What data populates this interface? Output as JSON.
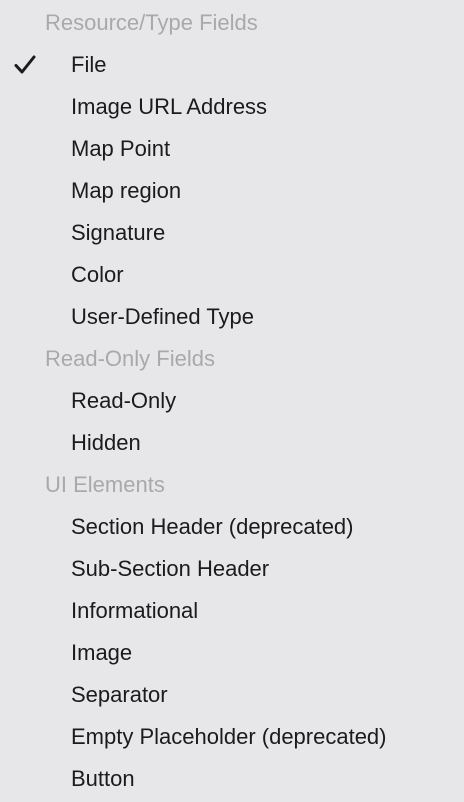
{
  "menu": {
    "sections": [
      {
        "header": "Resource/Type Fields",
        "items": [
          {
            "label": "File",
            "checked": true
          },
          {
            "label": "Image URL Address",
            "checked": false
          },
          {
            "label": "Map Point",
            "checked": false
          },
          {
            "label": "Map region",
            "checked": false
          },
          {
            "label": "Signature",
            "checked": false
          },
          {
            "label": "Color",
            "checked": false
          },
          {
            "label": "User-Defined Type",
            "checked": false
          }
        ]
      },
      {
        "header": "Read-Only Fields",
        "items": [
          {
            "label": "Read-Only",
            "checked": false
          },
          {
            "label": "Hidden",
            "checked": false
          }
        ]
      },
      {
        "header": "UI Elements",
        "items": [
          {
            "label": "Section Header (deprecated)",
            "checked": false
          },
          {
            "label": "Sub-Section Header",
            "checked": false
          },
          {
            "label": "Informational",
            "checked": false
          },
          {
            "label": "Image",
            "checked": false
          },
          {
            "label": "Separator",
            "checked": false
          },
          {
            "label": "Empty Placeholder (deprecated)",
            "checked": false
          },
          {
            "label": "Button",
            "checked": false
          }
        ]
      }
    ],
    "check_icon": "checkmark-icon",
    "colors": {
      "background": "#e7e7e9",
      "header_text": "#a9a9ab",
      "item_text": "#1b1b1d"
    }
  }
}
